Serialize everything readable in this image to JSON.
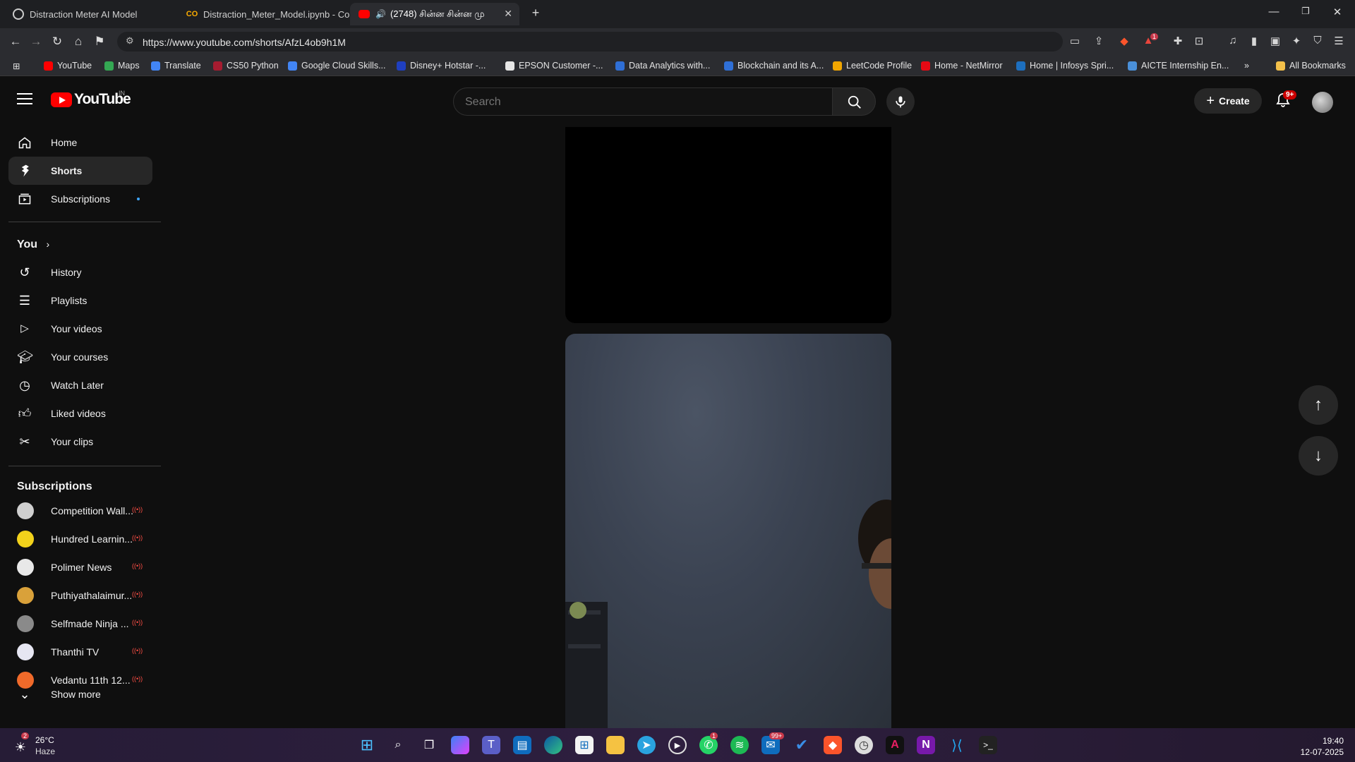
{
  "browser": {
    "tabs": [
      {
        "label": "Distraction Meter AI Model"
      },
      {
        "label": "Distraction_Meter_Model.ipynb - Col"
      },
      {
        "label": "(2748) சின்ன சின்ன மு"
      }
    ],
    "url": "https://www.youtube.com/shorts/AfzL4ob9h1M",
    "extension_badge": "1",
    "bookmarks": [
      {
        "label": "YouTube",
        "color": "#ff0000"
      },
      {
        "label": "Maps",
        "color": "#34a853"
      },
      {
        "label": "Translate",
        "color": "#4285f4"
      },
      {
        "label": "CS50 Python",
        "color": "#a51c30"
      },
      {
        "label": "Google Cloud Skills...",
        "color": "#4285f4"
      },
      {
        "label": "Disney+ Hotstar -...",
        "color": "#1f3fbf"
      },
      {
        "label": "EPSON Customer -...",
        "color": "#e6e6e6"
      },
      {
        "label": "Data Analytics with...",
        "color": "#2f6fd6"
      },
      {
        "label": "Blockchain and its A...",
        "color": "#2f6fd6"
      },
      {
        "label": "LeetCode Profile",
        "color": "#f0a500"
      },
      {
        "label": "Home - NetMirror",
        "color": "#e50914"
      },
      {
        "label": "Home | Infosys Spri...",
        "color": "#1d6fbf"
      },
      {
        "label": "AICTE Internship En...",
        "color": "#4a90d9"
      }
    ],
    "all_bookmarks": "All Bookmarks"
  },
  "youtube": {
    "logo_text": "YouTube",
    "country_code": "IN",
    "search_placeholder": "Search",
    "create_label": "Create",
    "notification_count": "9+",
    "sidebar": {
      "main": [
        {
          "label": "Home",
          "icon": "home-icon"
        },
        {
          "label": "Shorts",
          "icon": "shorts-icon"
        },
        {
          "label": "Subscriptions",
          "icon": "subscriptions-icon"
        }
      ],
      "you_heading": "You",
      "you_items": [
        {
          "label": "History",
          "icon": "history-icon"
        },
        {
          "label": "Playlists",
          "icon": "playlists-icon"
        },
        {
          "label": "Your videos",
          "icon": "your-videos-icon"
        },
        {
          "label": "Your courses",
          "icon": "courses-icon"
        },
        {
          "label": "Watch Later",
          "icon": "clock-icon"
        },
        {
          "label": "Liked videos",
          "icon": "thumbs-up-icon"
        },
        {
          "label": "Your clips",
          "icon": "scissors-icon"
        }
      ],
      "subscriptions_heading": "Subscriptions",
      "subscriptions": [
        {
          "label": "Competition Wall...",
          "color": "#cfcfcf"
        },
        {
          "label": "Hundred Learnin...",
          "color": "#f2d21b"
        },
        {
          "label": "Polimer News",
          "color": "#e8e8e8"
        },
        {
          "label": "Puthiyathalaimur...",
          "color": "#d9a13a"
        },
        {
          "label": "Selfmade Ninja ...",
          "color": "#8a8a8a"
        },
        {
          "label": "Thanthi TV",
          "color": "#e6e6f2"
        },
        {
          "label": "Vedantu 11th 12...",
          "color": "#f06a2a"
        }
      ],
      "show_more": "Show more"
    }
  },
  "taskbar": {
    "weather_temp": "26°C",
    "weather_condition": "Haze",
    "weather_badge": "2",
    "whatsapp_badge": "1",
    "mail_badge": "99+",
    "time": "19:40",
    "date": "12-07-2025"
  }
}
